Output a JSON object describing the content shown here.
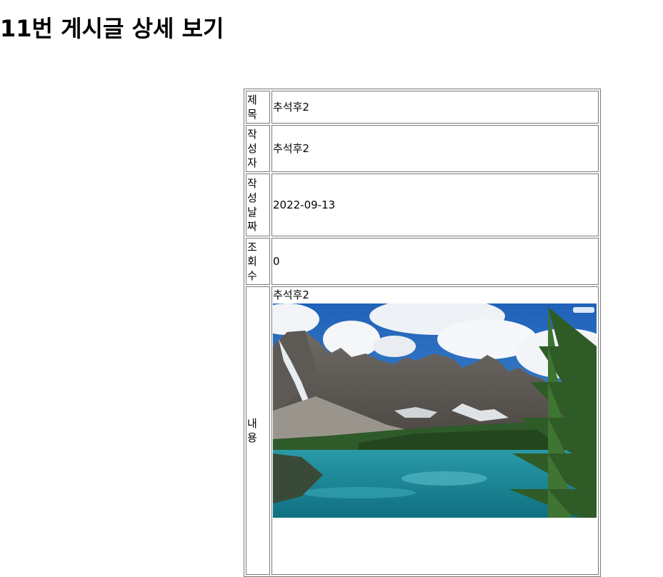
{
  "page": {
    "title": "11번 게시글 상세 보기"
  },
  "post": {
    "fields": [
      {
        "label": "제목",
        "value": "추석후2"
      },
      {
        "label": "작성자",
        "value": "추석후2"
      },
      {
        "label": "작성날짜",
        "value": "2022-09-13"
      },
      {
        "label": "조회수",
        "value": "0"
      }
    ],
    "content": {
      "label": "내용",
      "text": "추석후2",
      "image_name": "mountain-lake-image"
    }
  }
}
